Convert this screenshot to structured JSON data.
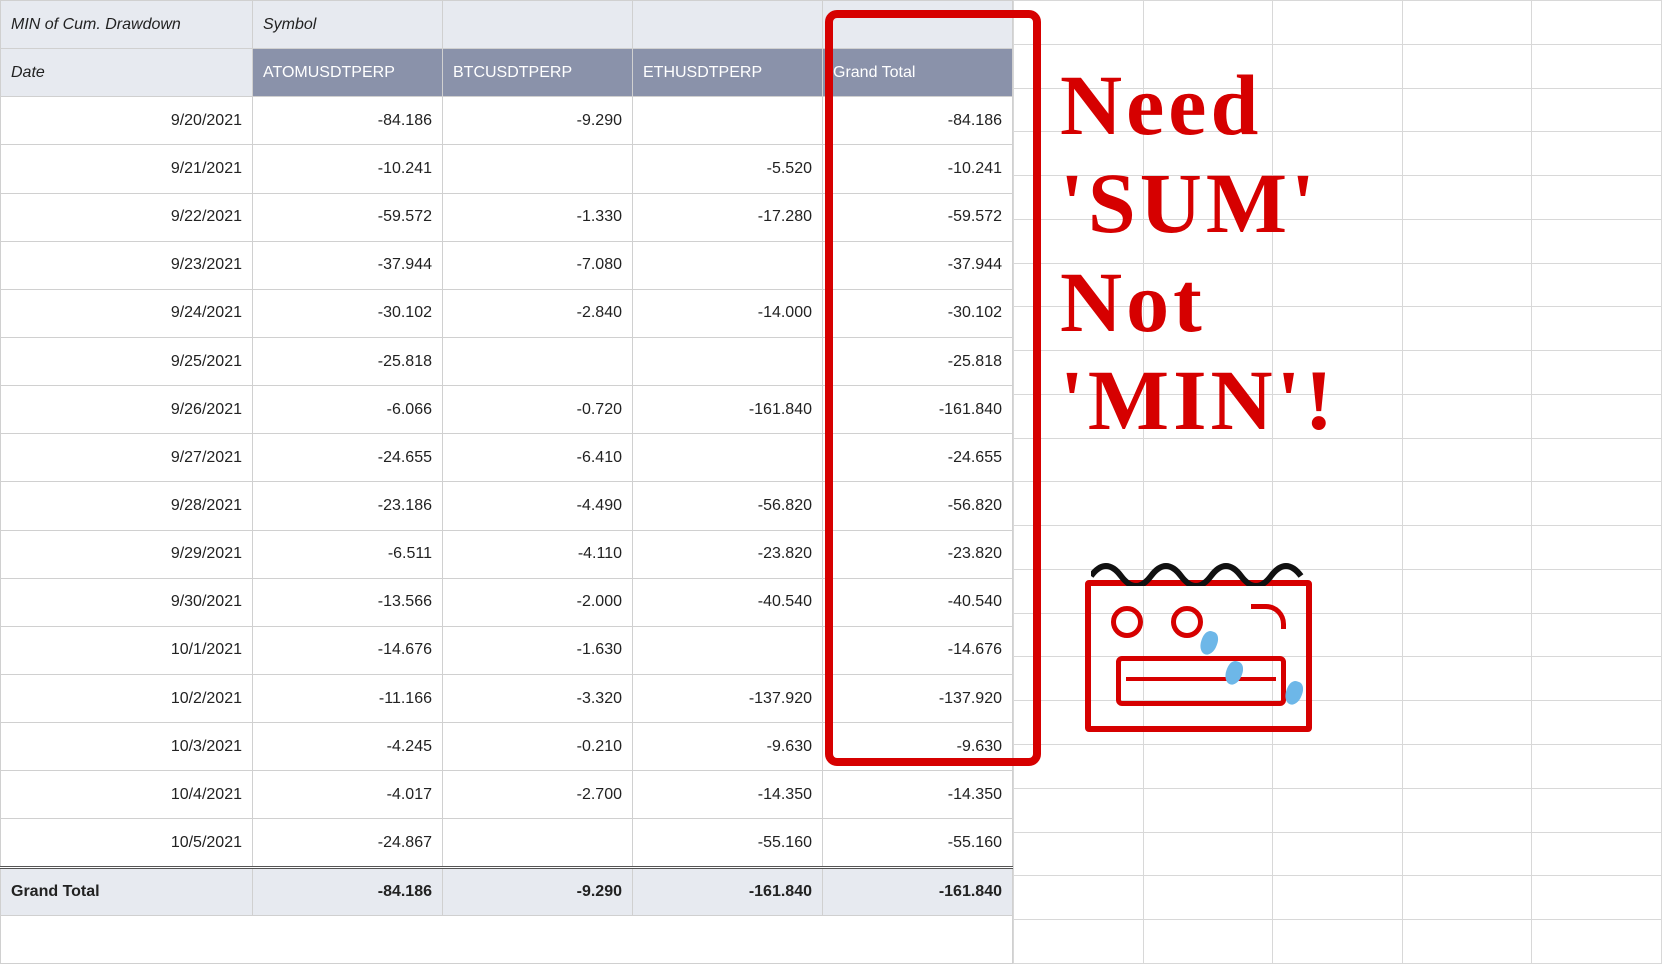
{
  "pivot": {
    "header": {
      "measure_label": "MIN of Cum. Drawdown",
      "col_field_label": "Symbol",
      "row_field_label": "Date",
      "columns": [
        "ATOMUSDTPERP",
        "BTCUSDTPERP",
        "ETHUSDTPERP",
        "Grand Total"
      ]
    },
    "rows": [
      {
        "date": "9/20/2021",
        "ATOMUSDTPERP": "-84.186",
        "BTCUSDTPERP": "-9.290",
        "ETHUSDTPERP": "",
        "Grand Total": "-84.186"
      },
      {
        "date": "9/21/2021",
        "ATOMUSDTPERP": "-10.241",
        "BTCUSDTPERP": "",
        "ETHUSDTPERP": "-5.520",
        "Grand Total": "-10.241"
      },
      {
        "date": "9/22/2021",
        "ATOMUSDTPERP": "-59.572",
        "BTCUSDTPERP": "-1.330",
        "ETHUSDTPERP": "-17.280",
        "Grand Total": "-59.572"
      },
      {
        "date": "9/23/2021",
        "ATOMUSDTPERP": "-37.944",
        "BTCUSDTPERP": "-7.080",
        "ETHUSDTPERP": "",
        "Grand Total": "-37.944"
      },
      {
        "date": "9/24/2021",
        "ATOMUSDTPERP": "-30.102",
        "BTCUSDTPERP": "-2.840",
        "ETHUSDTPERP": "-14.000",
        "Grand Total": "-30.102"
      },
      {
        "date": "9/25/2021",
        "ATOMUSDTPERP": "-25.818",
        "BTCUSDTPERP": "",
        "ETHUSDTPERP": "",
        "Grand Total": "-25.818"
      },
      {
        "date": "9/26/2021",
        "ATOMUSDTPERP": "-6.066",
        "BTCUSDTPERP": "-0.720",
        "ETHUSDTPERP": "-161.840",
        "Grand Total": "-161.840"
      },
      {
        "date": "9/27/2021",
        "ATOMUSDTPERP": "-24.655",
        "BTCUSDTPERP": "-6.410",
        "ETHUSDTPERP": "",
        "Grand Total": "-24.655"
      },
      {
        "date": "9/28/2021",
        "ATOMUSDTPERP": "-23.186",
        "BTCUSDTPERP": "-4.490",
        "ETHUSDTPERP": "-56.820",
        "Grand Total": "-56.820"
      },
      {
        "date": "9/29/2021",
        "ATOMUSDTPERP": "-6.511",
        "BTCUSDTPERP": "-4.110",
        "ETHUSDTPERP": "-23.820",
        "Grand Total": "-23.820"
      },
      {
        "date": "9/30/2021",
        "ATOMUSDTPERP": "-13.566",
        "BTCUSDTPERP": "-2.000",
        "ETHUSDTPERP": "-40.540",
        "Grand Total": "-40.540"
      },
      {
        "date": "10/1/2021",
        "ATOMUSDTPERP": "-14.676",
        "BTCUSDTPERP": "-1.630",
        "ETHUSDTPERP": "",
        "Grand Total": "-14.676"
      },
      {
        "date": "10/2/2021",
        "ATOMUSDTPERP": "-11.166",
        "BTCUSDTPERP": "-3.320",
        "ETHUSDTPERP": "-137.920",
        "Grand Total": "-137.920"
      },
      {
        "date": "10/3/2021",
        "ATOMUSDTPERP": "-4.245",
        "BTCUSDTPERP": "-0.210",
        "ETHUSDTPERP": "-9.630",
        "Grand Total": "-9.630"
      },
      {
        "date": "10/4/2021",
        "ATOMUSDTPERP": "-4.017",
        "BTCUSDTPERP": "-2.700",
        "ETHUSDTPERP": "-14.350",
        "Grand Total": "-14.350"
      },
      {
        "date": "10/5/2021",
        "ATOMUSDTPERP": "-24.867",
        "BTCUSDTPERP": "",
        "ETHUSDTPERP": "-55.160",
        "Grand Total": "-55.160"
      }
    ],
    "grand_total": {
      "label": "Grand Total",
      "ATOMUSDTPERP": "-84.186",
      "BTCUSDTPERP": "-9.290",
      "ETHUSDTPERP": "-161.840",
      "Grand Total": "-161.840"
    }
  },
  "annotation": {
    "line1": "Need",
    "line2": "'SUM'",
    "line3": "Not",
    "line4": "'MIN'!"
  }
}
